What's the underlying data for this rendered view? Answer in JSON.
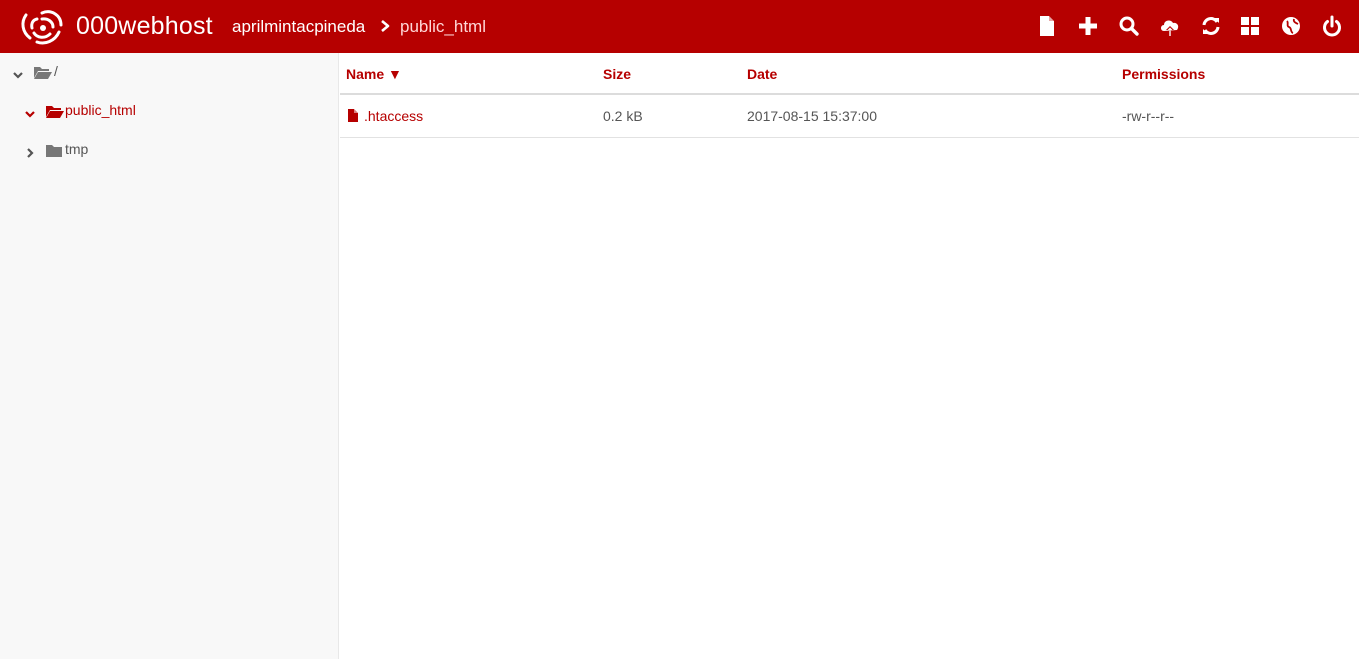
{
  "app": {
    "brand": "000webhost",
    "colors": {
      "primary": "#b60000",
      "text": "#555555",
      "sidebar_bg": "#f8f8f8"
    }
  },
  "breadcrumb": {
    "user": "aprilmintacpineda",
    "separator_icon": "chevron-right-icon",
    "current": "public_html"
  },
  "toolbar": {
    "icons": [
      "new-file-icon",
      "new-folder-plus-icon",
      "search-icon",
      "upload-cloud-icon",
      "refresh-icon",
      "grid-view-icon",
      "globe-icon",
      "power-icon"
    ]
  },
  "tree": {
    "root": {
      "label": "/",
      "expanded": true
    },
    "items": [
      {
        "label": "public_html",
        "expanded": true,
        "active": true
      },
      {
        "label": "tmp",
        "expanded": false,
        "active": false
      }
    ]
  },
  "table": {
    "headers": {
      "name": "Name ▼",
      "size": "Size",
      "date": "Date",
      "permissions": "Permissions"
    },
    "rows": [
      {
        "name": ".htaccess",
        "size": "0.2 kB",
        "date": "2017-08-15 15:37:00",
        "permissions": "-rw-r--r--"
      }
    ]
  }
}
